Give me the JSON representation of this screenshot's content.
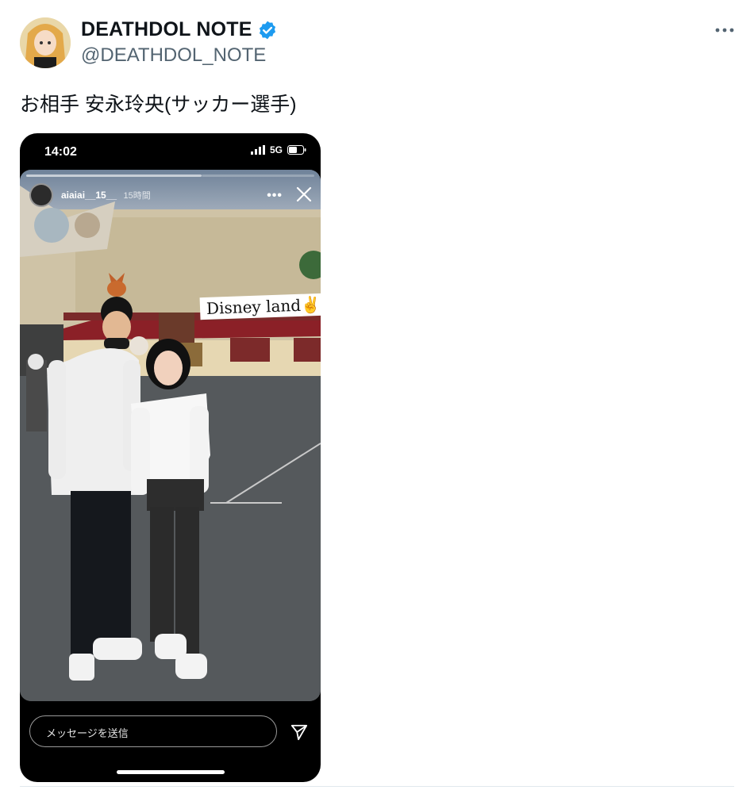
{
  "author": {
    "display_name": "DEATHDOL NOTE",
    "handle": "@DEATHDOL_NOTE",
    "verified": true
  },
  "tweet": {
    "text": "お相手 安永玲央(サッカー選手)"
  },
  "story": {
    "status_time": "14:02",
    "network": "5G",
    "username": "aiaiai__15__",
    "age": "15時間",
    "sticker_text": "Disney land✌✌",
    "reply_placeholder": "メッセージを送信"
  },
  "icons": {
    "verified": "verified-badge-icon",
    "more": "more-icon",
    "close": "close-icon",
    "send": "send-icon"
  },
  "colors": {
    "verified_blue": "#1d9bf0",
    "handle_gray": "#536471"
  }
}
